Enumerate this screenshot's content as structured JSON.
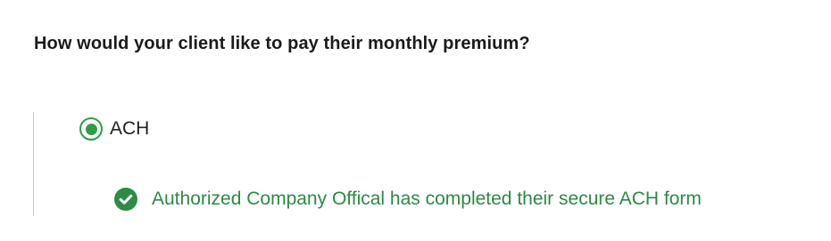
{
  "question": {
    "text": "How would your client like to pay their monthly premium?"
  },
  "payment_options": [
    {
      "label": "ACH",
      "selected": true,
      "icon": "radio-selected-icon"
    }
  ],
  "status": {
    "text": "Authorized Company Offical has completed their secure ACH form",
    "icon": "check-circle-icon"
  },
  "colors": {
    "accent_green": "#2e9e45",
    "status_text": "#2c8a43",
    "question_text": "#1b1b1b",
    "divider": "#c8c8c8"
  }
}
